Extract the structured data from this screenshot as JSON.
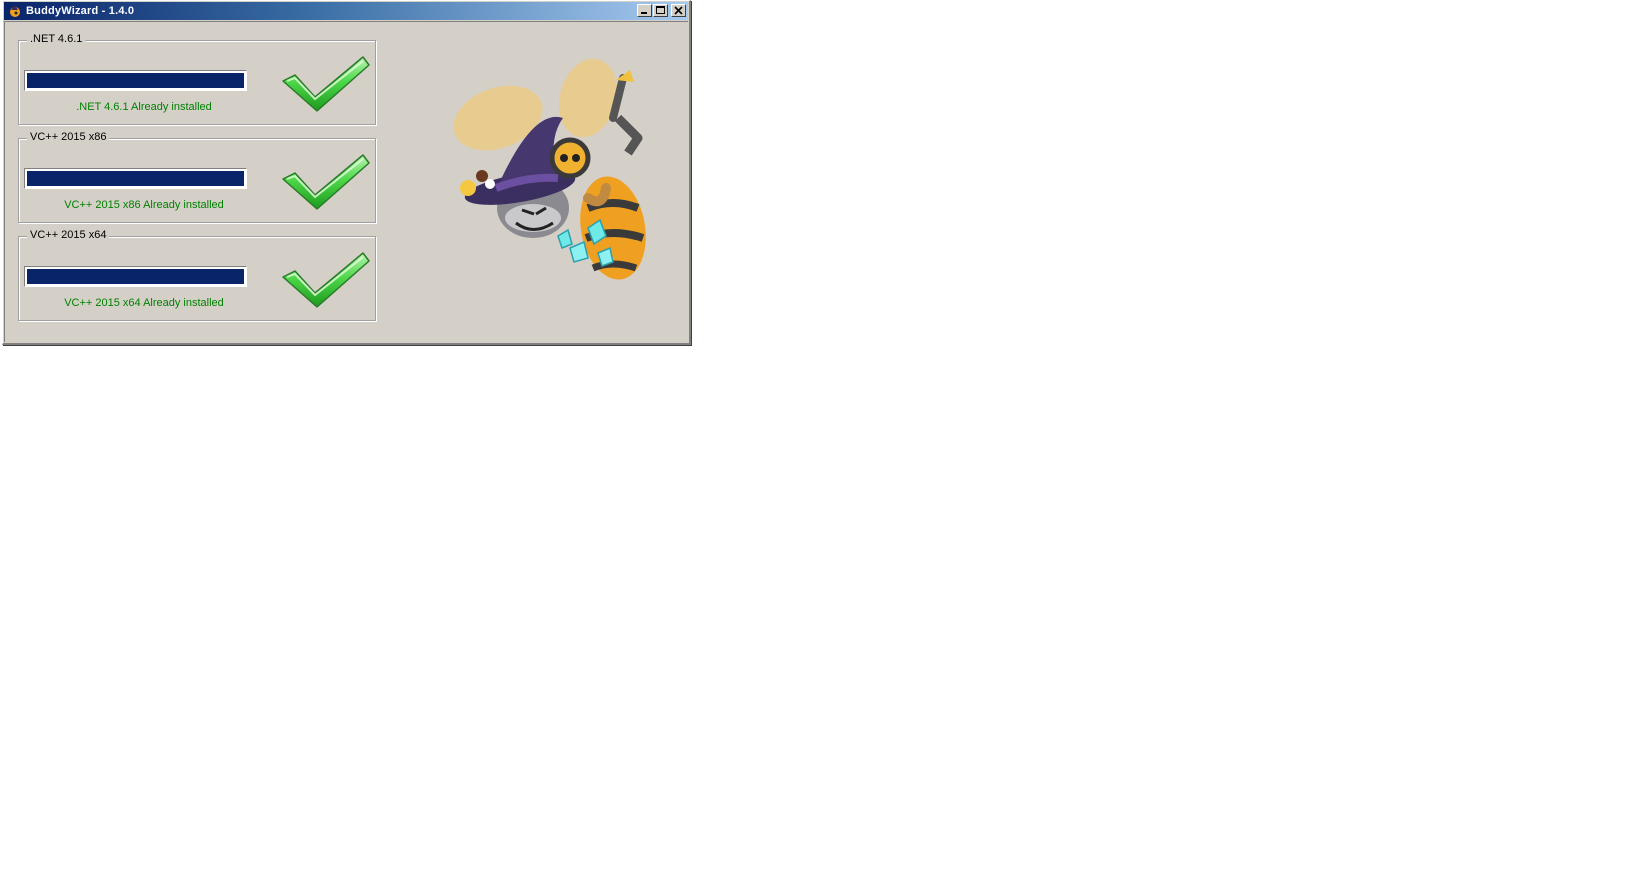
{
  "window": {
    "title": "BuddyWizard - 1.4.0",
    "app_icon": "buddy-icon",
    "buttons": {
      "minimize": "minimize-icon",
      "maximize": "maximize-icon",
      "close": "close-icon"
    }
  },
  "components": [
    {
      "name": ".NET 4.6.1",
      "progress": 1.0,
      "status": ".NET 4.6.1 Already installed",
      "icon": "checkmark-icon"
    },
    {
      "name": "VC++ 2015 x86",
      "progress": 1.0,
      "status": "VC++ 2015 x86 Already installed",
      "icon": "checkmark-icon"
    },
    {
      "name": "VC++ 2015 x64",
      "progress": 1.0,
      "status": "VC++ 2015 x64 Already installed",
      "icon": "checkmark-icon"
    }
  ],
  "colors": {
    "progress_fill": "#0a246a",
    "status_text": "#008000",
    "check_green": "#3cc43c"
  },
  "illustration": "wizard-bee-mascot"
}
